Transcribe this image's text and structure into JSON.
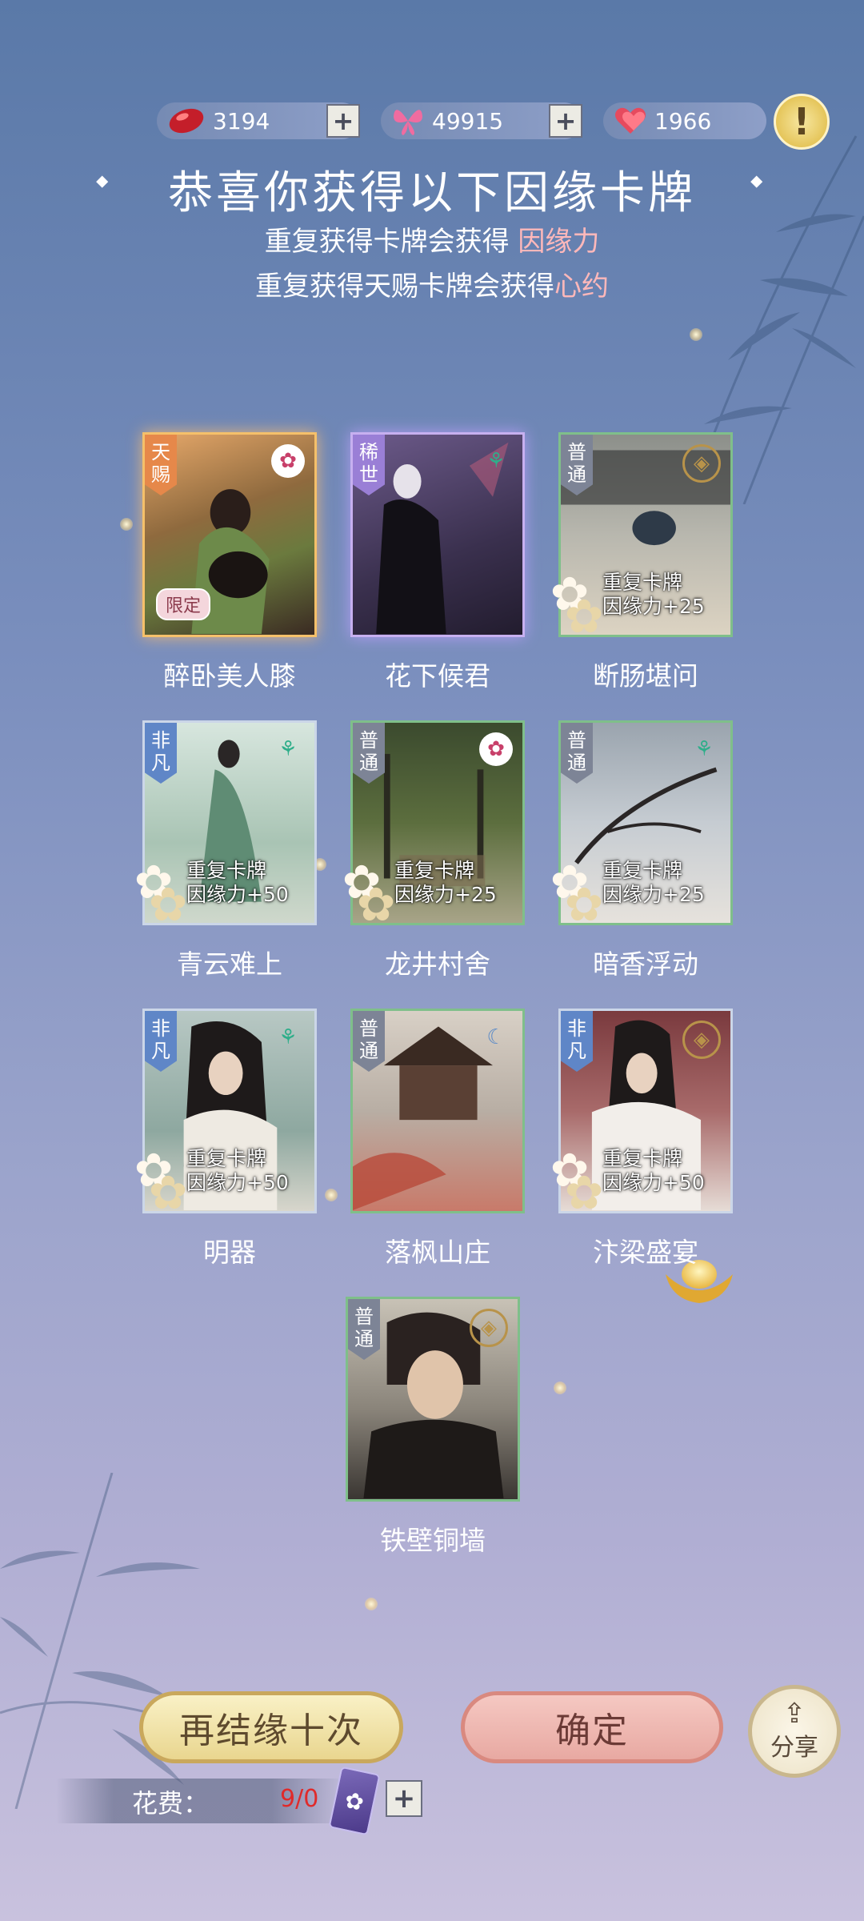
{
  "currencies": [
    {
      "name": "red-gem",
      "value": "3194",
      "has_plus": true,
      "icon": "red-gem-icon"
    },
    {
      "name": "butterfly",
      "value": "49915",
      "has_plus": true,
      "icon": "butterfly-icon"
    },
    {
      "name": "heart",
      "value": "1966",
      "has_plus": false,
      "icon": "heart-icon"
    }
  ],
  "warn_symbol": "!",
  "title": "恭喜你获得以下因缘卡牌",
  "sub1_prefix": "重复获得卡牌会获得 ",
  "sub1_highlight": "因缘力",
  "sub2_prefix": "重复获得天赐卡牌会获得",
  "sub2_highlight": "心约",
  "cards": [
    {
      "name": "醉卧美人膝",
      "rank": "天赐",
      "emblem": "flower-emblem",
      "limited": "限定",
      "dup": null
    },
    {
      "name": "花下候君",
      "rank": "稀世",
      "emblem": "leaf-emblem",
      "limited": null,
      "dup": null
    },
    {
      "name": "断肠堪问",
      "rank": "普通",
      "emblem": "coin-emblem",
      "limited": null,
      "dup": {
        "line1": "重复卡牌",
        "line2": "因缘力+25"
      }
    },
    {
      "name": "青云难上",
      "rank": "非凡",
      "emblem": "leaf-emblem",
      "limited": null,
      "dup": {
        "line1": "重复卡牌",
        "line2": "因缘力+50"
      }
    },
    {
      "name": "龙井村舍",
      "rank": "普通",
      "emblem": "flower-emblem",
      "limited": null,
      "dup": {
        "line1": "重复卡牌",
        "line2": "因缘力+25"
      }
    },
    {
      "name": "暗香浮动",
      "rank": "普通",
      "emblem": "leaf-emblem",
      "limited": null,
      "dup": {
        "line1": "重复卡牌",
        "line2": "因缘力+25"
      }
    },
    {
      "name": "明器",
      "rank": "非凡",
      "emblem": "leaf-emblem",
      "limited": null,
      "dup": {
        "line1": "重复卡牌",
        "line2": "因缘力+50"
      }
    },
    {
      "name": "落枫山庄",
      "rank": "普通",
      "emblem": "moon-emblem",
      "limited": null,
      "dup": null
    },
    {
      "name": "汴梁盛宴",
      "rank": "非凡",
      "emblem": "coin-emblem",
      "limited": null,
      "dup": {
        "line1": "重复卡牌",
        "line2": "因缘力+50"
      }
    },
    {
      "name": "铁壁铜墙",
      "rank": "普通",
      "emblem": "coin-emblem",
      "limited": null,
      "dup": null
    }
  ],
  "buttons": {
    "again": "再结缘十次",
    "confirm": "确定",
    "share": "分享"
  },
  "cost": {
    "label": "花费：",
    "value": "9/0"
  },
  "colors": {
    "tianci": "#e6884a",
    "xishi": "#9a7fd6",
    "feifan": "#5f86c7",
    "putong": "#7d8496",
    "highlight": "#ffb8ba",
    "cost_red": "#e02a2a"
  }
}
